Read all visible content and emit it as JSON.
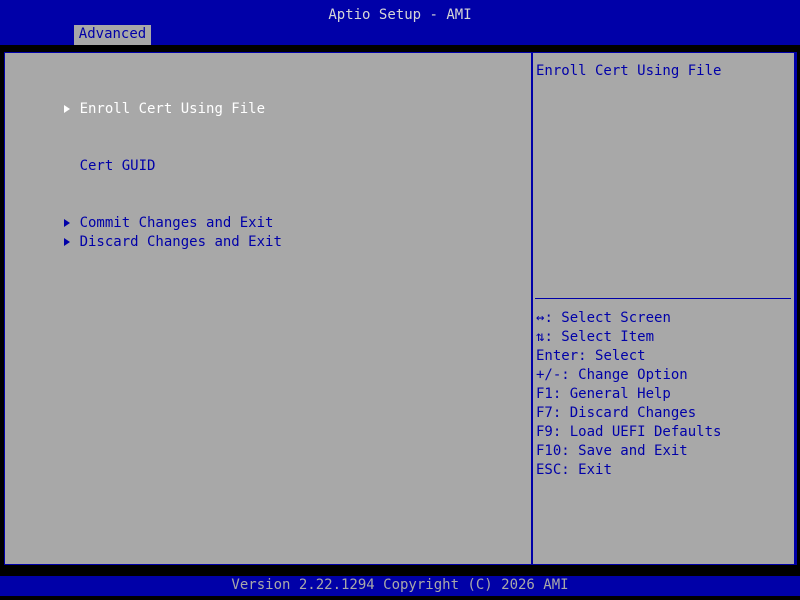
{
  "header": {
    "title": "Aptio Setup - AMI",
    "tabs": [
      {
        "label": "Advanced",
        "active": true
      }
    ]
  },
  "menu": {
    "items": [
      {
        "label": "Enroll Cert Using File",
        "submenu": true,
        "selected": true
      },
      {
        "label": "Cert GUID",
        "submenu": false,
        "selected": false
      },
      {
        "label": "Commit Changes and Exit",
        "submenu": true,
        "selected": false
      },
      {
        "label": "Discard Changes and Exit",
        "submenu": true,
        "selected": false
      }
    ]
  },
  "help": {
    "title": "Enroll Cert Using File",
    "keys": [
      {
        "key": "↔",
        "desc": ": Select Screen"
      },
      {
        "key": "⇅",
        "desc": ": Select Item"
      },
      {
        "key": "Enter",
        "desc": ": Select"
      },
      {
        "key": "+/-",
        "desc": ": Change Option"
      },
      {
        "key": "F1",
        "desc": ": General Help"
      },
      {
        "key": "F7",
        "desc": ": Discard Changes"
      },
      {
        "key": "F9",
        "desc": ": Load UEFI Defaults"
      },
      {
        "key": "F10",
        "desc": ": Save and Exit"
      },
      {
        "key": "ESC",
        "desc": ": Exit"
      }
    ]
  },
  "footer": {
    "version": "Version 2.22.1294 Copyright (C) 2026 AMI"
  },
  "colors": {
    "bios_blue": "#0000a8",
    "panel_gray": "#a8a8a8",
    "selected_text": "#ffffff",
    "title_text": "#d6d6d6"
  }
}
